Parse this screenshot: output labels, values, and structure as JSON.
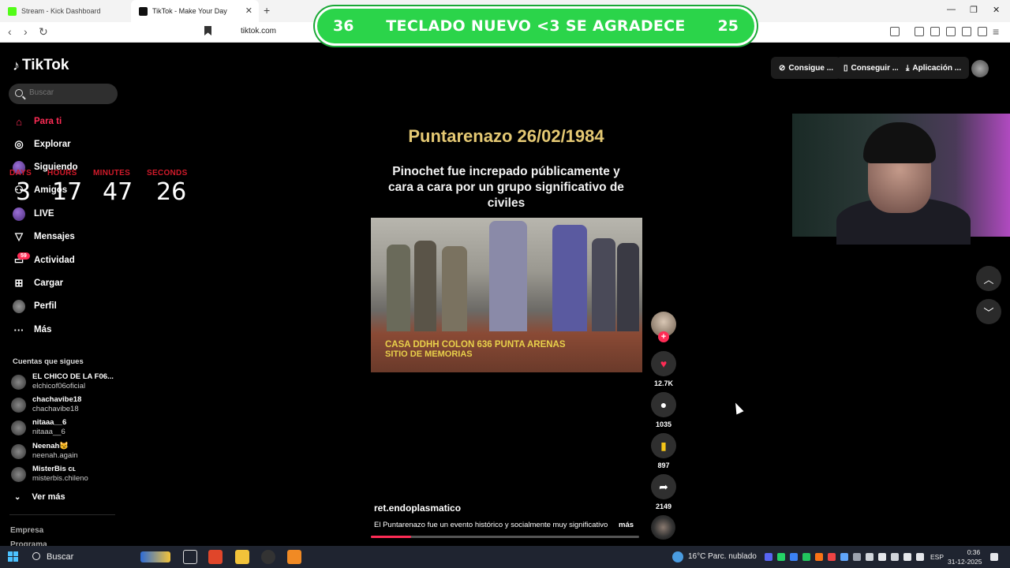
{
  "browser": {
    "tabs": [
      {
        "label": "Stream - Kick Dashboard"
      },
      {
        "label": "TikTok - Make Your Day"
      }
    ],
    "url": "tiktok.com"
  },
  "overlay": {
    "left_count": "36",
    "message": "TECLADO NUEVO <3 SE AGRADECE",
    "right_count": "25"
  },
  "sidebar": {
    "logo": "TikTok",
    "search_placeholder": "Buscar",
    "items": [
      {
        "label": "Para ti"
      },
      {
        "label": "Explorar"
      },
      {
        "label": "Siguiendo"
      },
      {
        "label": "Amigos"
      },
      {
        "label": "LIVE"
      },
      {
        "label": "Mensajes"
      },
      {
        "label": "Actividad",
        "badge": "59"
      },
      {
        "label": "Cargar"
      },
      {
        "label": "Perfil"
      },
      {
        "label": "Más"
      }
    ],
    "following_title": "Cuentas que sigues",
    "accounts": [
      {
        "name": "EL CHICO DE LA F06...",
        "user": "elchicof06oficial"
      },
      {
        "name": "chachavibe18",
        "user": "chachavibe18"
      },
      {
        "name": "nitaaa__6",
        "user": "nitaaa__6"
      },
      {
        "name": "Neenah😼",
        "user": "neenah.again"
      },
      {
        "name": "MisterBis ᴄʟ",
        "user": "misterbis.chileno"
      }
    ],
    "see_more": "Ver más",
    "footer": [
      "Empresa",
      "Programa"
    ]
  },
  "timer": {
    "labels": [
      "DAYS",
      "HOURS",
      "MINUTES",
      "SECONDS"
    ],
    "values": [
      "3",
      "17",
      "47",
      "26"
    ]
  },
  "video": {
    "title": "Puntarenazo 26/02/1984",
    "subtitle": "Pinochet fue increpado públicamente y cara a cara por un grupo significativo de civiles",
    "caption_line1": "CASA DDHH COLON 636 PUNTA ARENAS",
    "caption_line2": "SITIO DE MEMORIAS",
    "author": "ret.endoplasmatico",
    "description": "El Puntarenazo fue un evento histórico y socialmente muy significativo",
    "more": "más",
    "progress": 0.15
  },
  "actions": {
    "likes": "12.7K",
    "comments": "1035",
    "saves": "897",
    "shares": "2149"
  },
  "topbar": {
    "buttons": [
      "Consigue ...",
      "Conseguir ...",
      "Aplicación ..."
    ]
  },
  "taskbar": {
    "search": "Buscar",
    "weather": "16°C  Parc. nublado",
    "lang": "ESP",
    "time": "0:36",
    "date": "31-12-2025"
  },
  "colors": {
    "accent": "#fe2c55",
    "banner": "#2bd44a",
    "timer_label": "#d11a2a",
    "title_gold": "#e4c873"
  }
}
